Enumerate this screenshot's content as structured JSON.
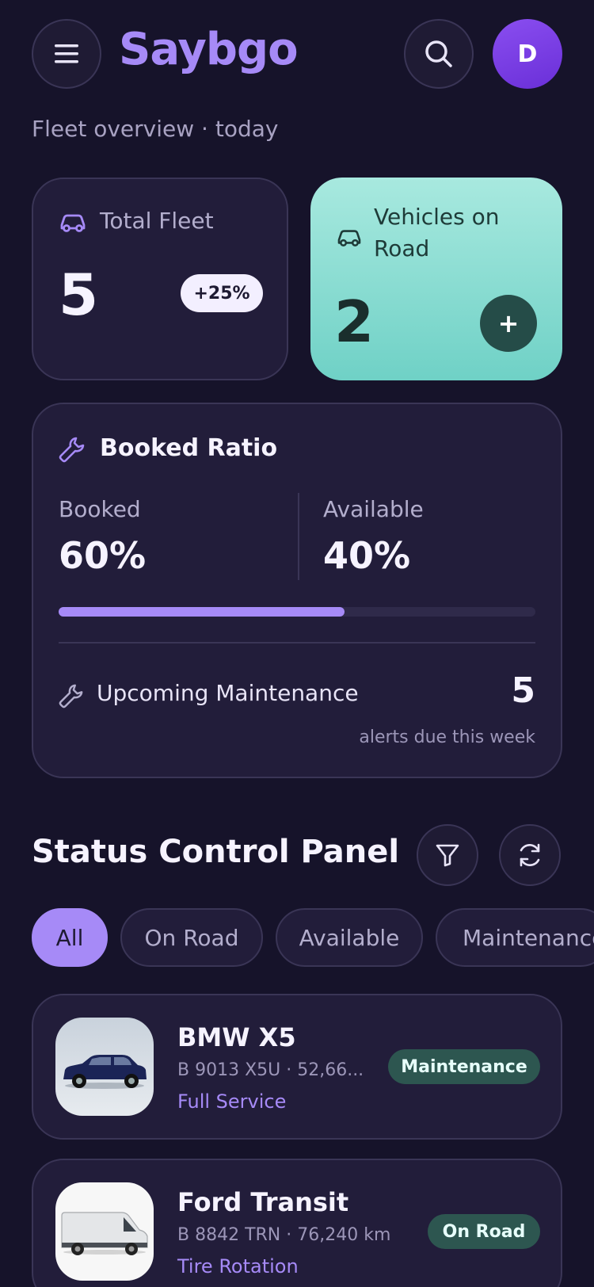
{
  "header": {
    "brand": "Saybgo",
    "avatar_initial": "D",
    "subtitle": "Fleet overview · today"
  },
  "stats": {
    "total_fleet": {
      "label": "Total Fleet",
      "value": "5",
      "change": "+25%"
    },
    "on_road": {
      "label": "Vehicles on Road",
      "value": "2"
    }
  },
  "booked_ratio": {
    "title": "Booked Ratio",
    "booked_label": "Booked",
    "booked_value": "60%",
    "available_label": "Available",
    "available_value": "40%",
    "booked_fraction": 0.6,
    "maintenance_label": "Upcoming Maintenance",
    "maintenance_count": "5",
    "maintenance_note": "alerts due this week"
  },
  "status_panel": {
    "title": "Status Control Panel",
    "filters": [
      "All",
      "On Road",
      "Available",
      "Maintenance"
    ],
    "active_filter": "All"
  },
  "vehicles": [
    {
      "name": "BMW X5",
      "meta": "B 9013 X5U · 52,66...",
      "service": "Full Service",
      "status": "Maintenance"
    },
    {
      "name": "Ford Transit",
      "meta": "B 8842 TRN · 76,240 km",
      "service": "Tire Rotation",
      "status": "On Road"
    }
  ],
  "colors": {
    "background": "#16132a",
    "accent": "#a68af7",
    "teal": "#6fd1c6",
    "status_badge": "#2d5650"
  }
}
